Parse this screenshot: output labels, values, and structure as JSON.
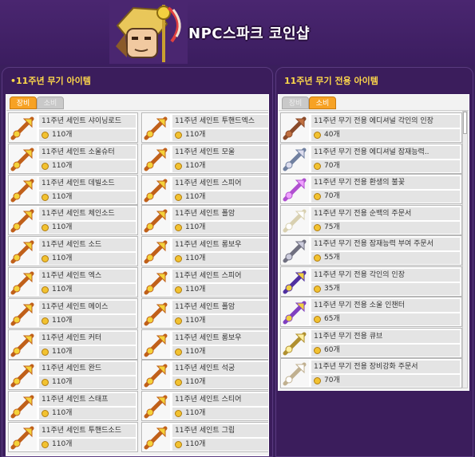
{
  "header": {
    "title": "NPC스파크 코인샵"
  },
  "left_section": {
    "title": "•11주년 무기 아이템",
    "tabs": [
      {
        "label": "장비"
      },
      {
        "label": "소비"
      }
    ],
    "items": [
      {
        "name": "11주년 세인트 샤이닝로드",
        "price": "110개",
        "icon": "rod-icon"
      },
      {
        "name": "11주년 세인트 투핸드엑스",
        "price": "110개",
        "icon": "twohand-axe-icon"
      },
      {
        "name": "11주년 세인트 소울슈터",
        "price": "110개",
        "icon": "soul-shooter-icon"
      },
      {
        "name": "11주년 세인트 모울",
        "price": "110개",
        "icon": "maul-icon"
      },
      {
        "name": "11주년 세인트 데빌소드",
        "price": "110개",
        "icon": "devil-sword-icon"
      },
      {
        "name": "11주년 세인트 스피어",
        "price": "110개",
        "icon": "spear-icon"
      },
      {
        "name": "11주년 세인트 체인소드",
        "price": "110개",
        "icon": "chain-sword-icon"
      },
      {
        "name": "11주년 세인트 폴암",
        "price": "110개",
        "icon": "polearm-icon"
      },
      {
        "name": "11주년 세인트 소드",
        "price": "110개",
        "icon": "sword-icon"
      },
      {
        "name": "11주년 세인트 롱보우",
        "price": "110개",
        "icon": "longbow-icon"
      },
      {
        "name": "11주년 세인트 엑스",
        "price": "110개",
        "icon": "axe-icon"
      },
      {
        "name": "11주년 세인트 스피어",
        "price": "110개",
        "icon": "spear-icon"
      },
      {
        "name": "11주년 세인트 메이스",
        "price": "110개",
        "icon": "mace-icon"
      },
      {
        "name": "11주년 세인트 폴암",
        "price": "110개",
        "icon": "polearm-icon"
      },
      {
        "name": "11주년 세인트 커터",
        "price": "110개",
        "icon": "cutter-icon"
      },
      {
        "name": "11주년 세인트 롱보우",
        "price": "110개",
        "icon": "longbow-icon"
      },
      {
        "name": "11주년 세인트 완드",
        "price": "110개",
        "icon": "wand-icon"
      },
      {
        "name": "11주년 세인트 석궁",
        "price": "110개",
        "icon": "crossbow-icon"
      },
      {
        "name": "11주년 세인트 스태프",
        "price": "110개",
        "icon": "staff-icon"
      },
      {
        "name": "11주년 세인트 스티어",
        "price": "110개",
        "icon": "steer-icon"
      },
      {
        "name": "11주년 세인트 투핸드소드",
        "price": "110개",
        "icon": "twohand-sword-icon"
      },
      {
        "name": "11주년 세인트 그립",
        "price": "110개",
        "icon": "grip-icon"
      }
    ]
  },
  "right_section": {
    "title": "11주년 무기 전용 아이템",
    "tabs": [
      {
        "label": "장비"
      },
      {
        "label": "소비"
      }
    ],
    "items": [
      {
        "name": "11주년 무기 전용 에디셔널 각인의 인장",
        "price": "40개",
        "icon": "stamp-icon"
      },
      {
        "name": "11주년 무기 전용 에디셔널 잠재능력..",
        "price": "70개",
        "icon": "scroll-icon"
      },
      {
        "name": "11주년 무기 전용 환생의 불꽃",
        "price": "70개",
        "icon": "flame-icon"
      },
      {
        "name": "11주년 무기 전용 순백의 주문서",
        "price": "75개",
        "icon": "white-scroll-icon"
      },
      {
        "name": "11주년 무기 전용 잠재능력 부여 주문서",
        "price": "55개",
        "icon": "potential-scroll-icon"
      },
      {
        "name": "11주년 무기 전용 각인의 인장",
        "price": "35개",
        "icon": "seal-icon"
      },
      {
        "name": "11주년 무기 전용 소울 인챈터",
        "price": "65개",
        "icon": "soul-enchanter-icon"
      },
      {
        "name": "11주년 무기 전용 큐브",
        "price": "60개",
        "icon": "cube-icon"
      },
      {
        "name": "11주년 무기 전용 장비강화 주문서",
        "price": "70개",
        "icon": "enhance-scroll-icon"
      }
    ]
  }
}
